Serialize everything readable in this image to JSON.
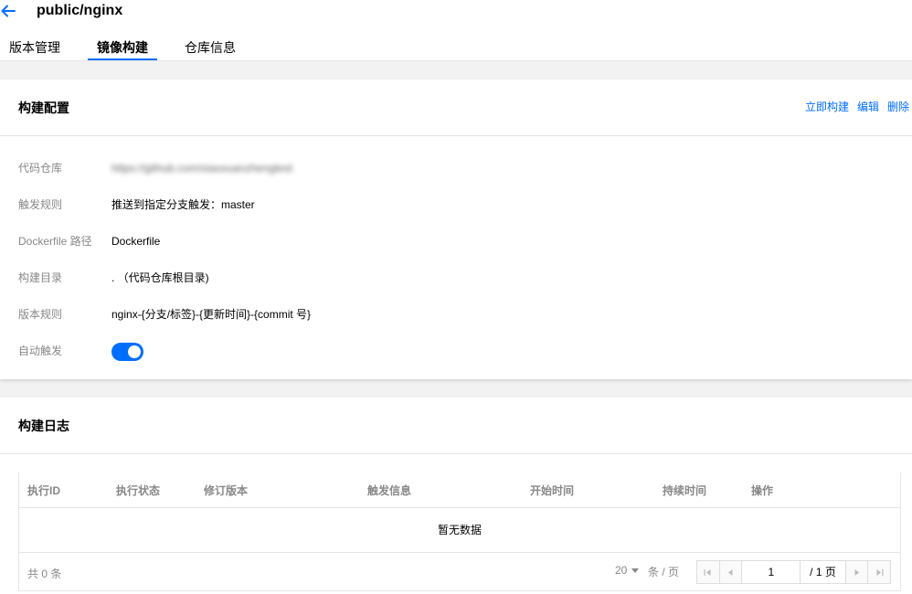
{
  "header": {
    "title": "public/nginx"
  },
  "tabs": [
    {
      "label": "版本管理"
    },
    {
      "label": "镜像构建"
    },
    {
      "label": "仓库信息"
    }
  ],
  "build_config": {
    "title": "构建配置",
    "actions": {
      "build_now": "立即构建",
      "edit": "编辑",
      "delete": "删除"
    },
    "rows": [
      {
        "label": "代码仓库",
        "value": "https://github.com/xiaoxuanzhengtest"
      },
      {
        "label": "触发规则",
        "value": "推送到指定分支触发：master"
      },
      {
        "label": "Dockerfile 路径",
        "value": "Dockerfile"
      },
      {
        "label": "构建目录",
        "value": ". （代码仓库根目录)"
      },
      {
        "label": "版本规则",
        "value": "nginx-{分支/标签}-{更新时间}-{commit 号}"
      },
      {
        "label": "自动触发",
        "value": ""
      }
    ],
    "auto_trigger_enabled": true,
    "accent_color": "#006eff"
  },
  "build_log": {
    "title": "构建日志",
    "columns": [
      "执行ID",
      "执行状态",
      "修订版本",
      "触发信息",
      "开始时间",
      "持续时间",
      "操作"
    ],
    "empty_text": "暂无数据",
    "pagination": {
      "total": "共 0 条",
      "page_size": "20",
      "per_page": "条 / 页",
      "current_page": "1",
      "total_pages": "/ 1 页"
    }
  }
}
